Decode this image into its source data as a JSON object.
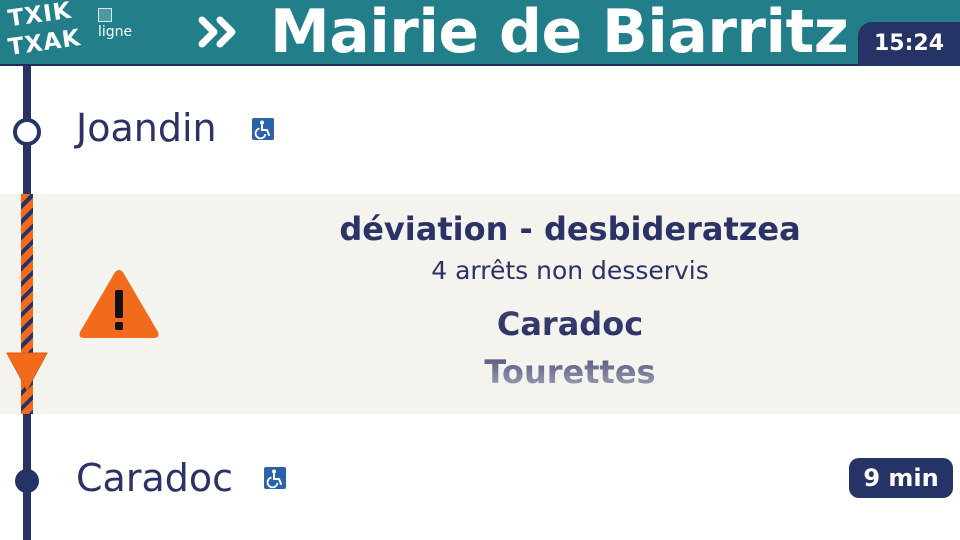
{
  "header": {
    "logo_line1": "TXIK",
    "logo_line2": "TXAK",
    "line_image_alt": "ligne",
    "direction_icon": "double-chevron-right-icon",
    "destination": "Mairie de Biarritz",
    "clock": "15:24"
  },
  "stops": [
    {
      "name": "Joandin",
      "accessible": true,
      "accessible_icon": "wheelchair-icon",
      "marker": "open-circle"
    },
    {
      "name": "Caradoc",
      "accessible": true,
      "accessible_icon": "wheelchair-icon",
      "marker": "filled-circle",
      "wait": "9 min"
    }
  ],
  "deviation": {
    "title": "déviation - desbideratzea",
    "subtitle": "4 arrêts non desservis",
    "icon": "warning-icon",
    "skipped_stops": [
      "Caradoc",
      "Tourettes"
    ]
  },
  "colors": {
    "header_bg": "#227f8a",
    "navy": "#263367",
    "deviation_bg": "#f5f3ed",
    "deviation_orange": "#f26b1d",
    "accessibility_blue": "#2b62a8"
  }
}
